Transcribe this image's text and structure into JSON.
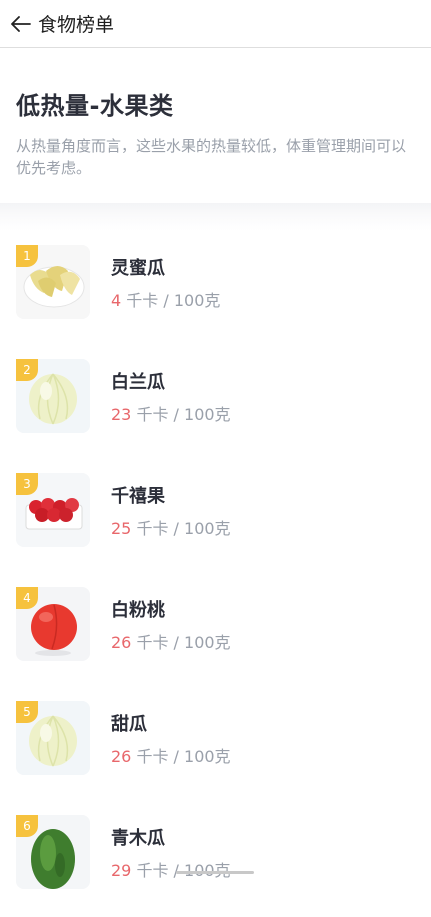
{
  "topbar": {
    "back_icon": "arrow-left-icon",
    "title": "食物榜单"
  },
  "header": {
    "title": "低热量-水果类",
    "subtitle": "从热量角度而言，这些水果的热量较低，体重管理期间可以优先考虑。"
  },
  "colors": {
    "rank_badge": "#f6c23e",
    "calorie_value": "#e8676b",
    "muted_text": "#9aa0aa"
  },
  "unit": "千卡 / 100克",
  "items": [
    {
      "rank": "1",
      "name": "灵蜜瓜",
      "calories": "4",
      "image": "melon-slices-bowl"
    },
    {
      "rank": "2",
      "name": "白兰瓜",
      "calories": "23",
      "image": "white-melon"
    },
    {
      "rank": "3",
      "name": "千禧果",
      "calories": "25",
      "image": "cherry-tomatoes-box"
    },
    {
      "rank": "4",
      "name": "白粉桃",
      "calories": "26",
      "image": "peach"
    },
    {
      "rank": "5",
      "name": "甜瓜",
      "calories": "26",
      "image": "sweet-melon"
    },
    {
      "rank": "6",
      "name": "青木瓜",
      "calories": "29",
      "image": "green-papaya"
    }
  ]
}
